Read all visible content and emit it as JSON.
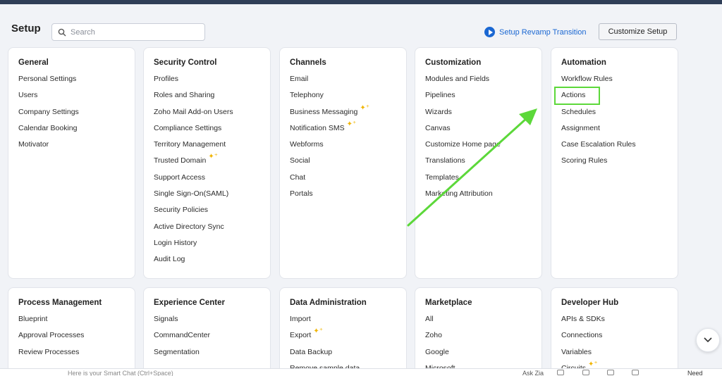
{
  "header": {
    "title": "Setup",
    "search_placeholder": "Search",
    "revamp_link": "Setup Revamp Transition",
    "customize_button": "Customize Setup"
  },
  "cards": {
    "general": {
      "title": "General",
      "items": [
        "Personal Settings",
        "Users",
        "Company Settings",
        "Calendar Booking",
        "Motivator"
      ]
    },
    "security": {
      "title": "Security Control",
      "items": [
        "Profiles",
        "Roles and Sharing",
        "Zoho Mail Add-on Users",
        "Compliance Settings",
        "Territory Management",
        "Trusted Domain",
        "Support Access",
        "Single Sign-On(SAML)",
        "Security Policies",
        "Active Directory Sync",
        "Login History",
        "Audit Log"
      ]
    },
    "channels": {
      "title": "Channels",
      "items": [
        "Email",
        "Telephony",
        "Business Messaging",
        "Notification SMS",
        "Webforms",
        "Social",
        "Chat",
        "Portals"
      ]
    },
    "customization": {
      "title": "Customization",
      "items": [
        "Modules and Fields",
        "Pipelines",
        "Wizards",
        "Canvas",
        "Customize Home page",
        "Translations",
        "Templates",
        "Marketing Attribution"
      ]
    },
    "automation": {
      "title": "Automation",
      "items": [
        "Workflow Rules",
        "Actions",
        "Schedules",
        "Assignment",
        "Case Escalation Rules",
        "Scoring Rules"
      ]
    },
    "process": {
      "title": "Process Management",
      "items": [
        "Blueprint",
        "Approval Processes",
        "Review Processes"
      ]
    },
    "experience": {
      "title": "Experience Center",
      "items": [
        "Signals",
        "CommandCenter",
        "Segmentation"
      ]
    },
    "data_admin": {
      "title": "Data Administration",
      "items": [
        "Import",
        "Export",
        "Data Backup",
        "Remove sample data"
      ]
    },
    "marketplace": {
      "title": "Marketplace",
      "items": [
        "All",
        "Zoho",
        "Google",
        "Microsoft"
      ]
    },
    "developer": {
      "title": "Developer Hub",
      "items": [
        "APIs & SDKs",
        "Connections",
        "Variables",
        "Circuits"
      ]
    }
  },
  "bottom_bar": {
    "zia_text": "Here is your Smart Chat (Ctrl+Space)",
    "ask_zia": "Ask Zia",
    "need_support": "Need Support"
  },
  "colors": {
    "accent": "#1a67d2",
    "highlight": "#5cd83a",
    "sparkle": "#f0b400"
  },
  "icons": {
    "sparkle": "sparkle-icon",
    "search": "search-icon",
    "play": "play-icon",
    "scroll": "chevron-down-icon"
  }
}
